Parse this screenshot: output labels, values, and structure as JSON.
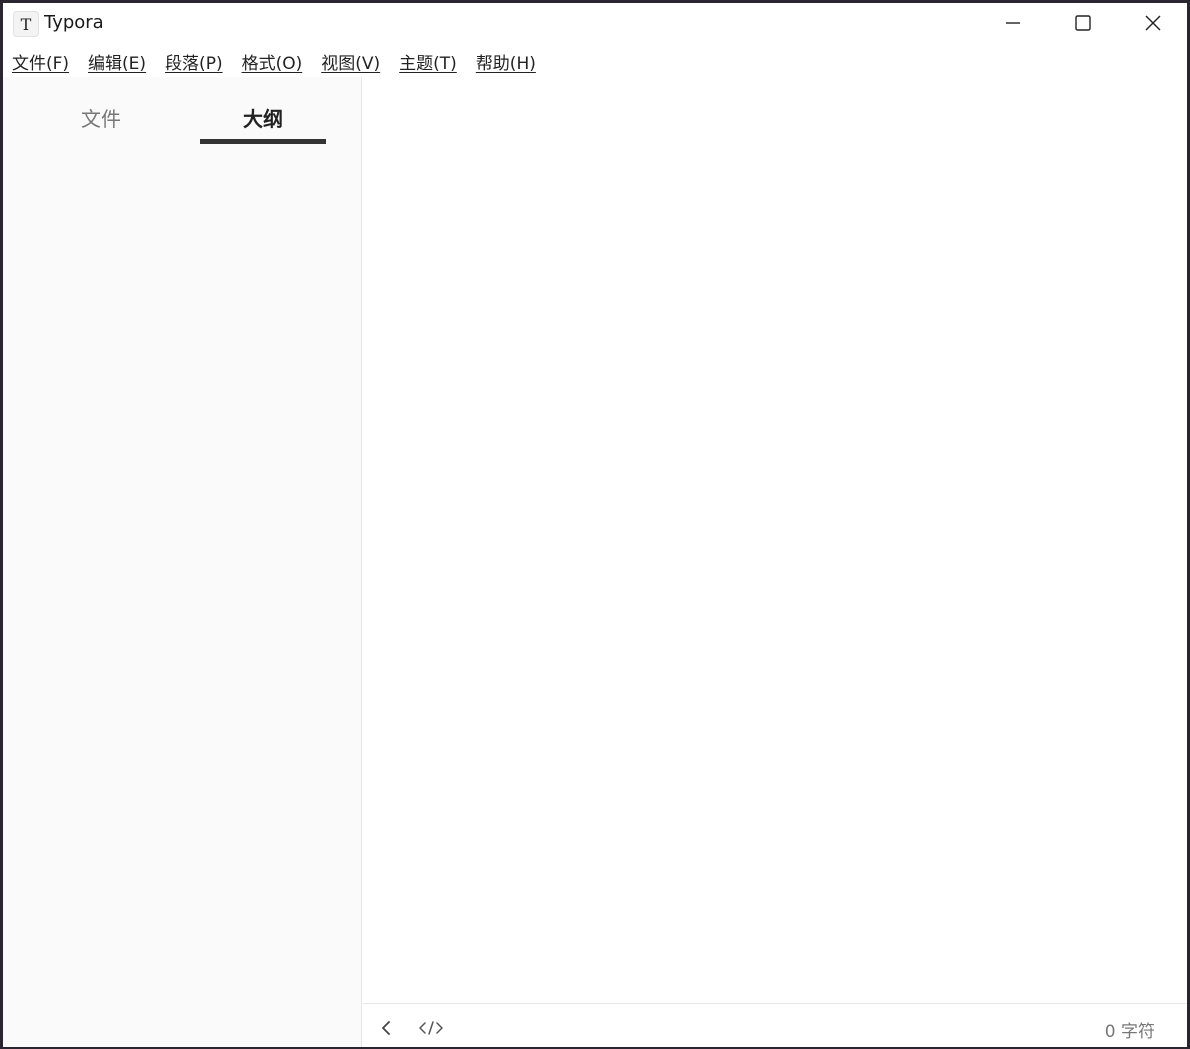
{
  "window": {
    "title": "Typora",
    "icon_letter": "T"
  },
  "menu": {
    "items": [
      {
        "label": "文件(F)"
      },
      {
        "label": "编辑(E)"
      },
      {
        "label": "段落(P)"
      },
      {
        "label": "格式(O)"
      },
      {
        "label": "视图(V)"
      },
      {
        "label": "主题(T)"
      },
      {
        "label": "帮助(H)"
      }
    ]
  },
  "sidebar": {
    "tabs": [
      {
        "label": "文件",
        "active": false
      },
      {
        "label": "大纲",
        "active": true
      }
    ]
  },
  "footer": {
    "word_count": "0 字符"
  },
  "icons": {
    "minimize": "minimize-icon",
    "maximize": "maximize-icon",
    "close": "close-icon",
    "sidebar_toggle": "chevron-left-icon",
    "source_mode": "code-icon"
  },
  "colors": {
    "sidebar_bg": "#fafafa",
    "active_tab_underline": "#333333",
    "muted_text": "#777777"
  }
}
